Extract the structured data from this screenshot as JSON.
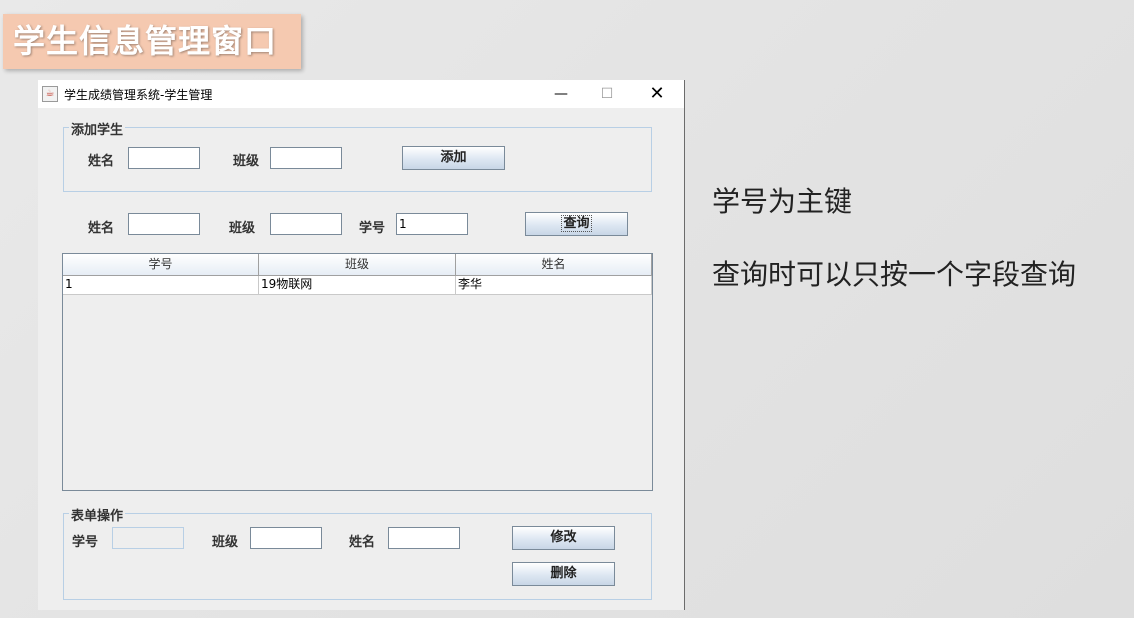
{
  "slide": {
    "title": "学生信息管理窗口",
    "note1": "学号为主键",
    "note2": "查询时可以只按一个字段查询"
  },
  "window": {
    "title": "学生成绩管理系统-学生管理",
    "icon": "java-cup-icon",
    "min_glyph": "—",
    "max_glyph": "☐",
    "close_glyph": "✕"
  },
  "add_group": {
    "title": "添加学生",
    "name_label": "姓名",
    "class_label": "班级",
    "name_value": "",
    "class_value": "",
    "add_button": "添加"
  },
  "query": {
    "name_label": "姓名",
    "class_label": "班级",
    "id_label": "学号",
    "name_value": "",
    "class_value": "",
    "id_value": "1",
    "query_button": "查询"
  },
  "table": {
    "columns": [
      "学号",
      "班级",
      "姓名"
    ],
    "rows": [
      [
        "1",
        "19物联网",
        "李华"
      ]
    ]
  },
  "form_group": {
    "title": "表单操作",
    "id_label": "学号",
    "class_label": "班级",
    "name_label": "姓名",
    "id_value": "",
    "class_value": "",
    "name_value": "",
    "modify_button": "修改",
    "delete_button": "删除"
  }
}
